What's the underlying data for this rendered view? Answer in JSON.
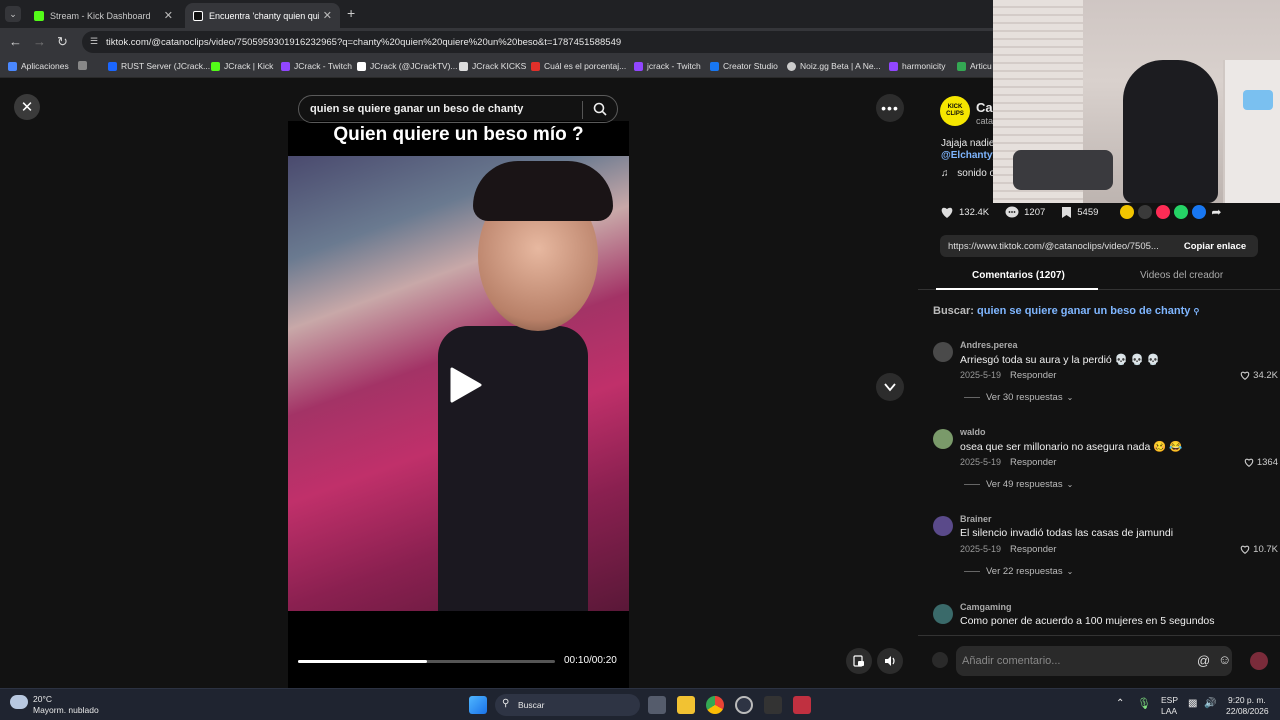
{
  "browser": {
    "tabs": [
      {
        "label": "Stream - Kick Dashboard",
        "favicon_color": "#53fc18"
      },
      {
        "label": "Encuentra 'chanty quien quiere",
        "favicon_color": "#ffffff"
      }
    ],
    "new_tab": "+",
    "url": "tiktok.com/@catanoclips/video/7505959301916232965?q=chanty%20quien%20quiere%20un%20beso&t=1787451588549",
    "bookmarks": [
      {
        "label": "Aplicaciones",
        "color": "#4a88ff"
      },
      {
        "label": "RUST Server (JCrack...",
        "color": "#1a66ff"
      },
      {
        "label": "JCrack | Kick",
        "color": "#53fc18"
      },
      {
        "label": "JCrack - Twitch",
        "color": "#9146ff"
      },
      {
        "label": "JCrack (@JCrackTV)...",
        "color": "#ffffff"
      },
      {
        "label": "JCrack KICKS",
        "color": "#ffffff"
      },
      {
        "label": "Cuál es el porcentaj...",
        "color": "#e0302a"
      },
      {
        "label": "jcrack - Twitch",
        "color": "#9146ff"
      },
      {
        "label": "Creator Studio",
        "color": "#1877f2"
      },
      {
        "label": "Noiz.gg Beta | A Ne...",
        "color": "#dddddd"
      },
      {
        "label": "harmonicity",
        "color": "#9146ff"
      },
      {
        "label": "Articu",
        "color": "#34a853"
      }
    ]
  },
  "player": {
    "search_query": "quien se quiere ganar un beso de chanty",
    "video_title": "Quien quiere un beso mío ?",
    "progress": 0.5,
    "time": "00:10/00:20"
  },
  "panel": {
    "channel_badge": "KICK CLIPS",
    "author_name": "Ca",
    "author_handle": "cata",
    "description": "Jajaja nadie",
    "mention": "@Elchantyy",
    "sound": "sonido o",
    "likes": "132.4K",
    "comments": "1207",
    "saves": "5459",
    "link": "https://www.tiktok.com/@catanoclips/video/7505...",
    "copy_link": "Copiar enlace",
    "tab_comments": "Comentarios (1207)",
    "tab_videos": "Videos del creador",
    "search_prefix": "Buscar:",
    "search_term": "quien se quiere ganar un beso de chanty",
    "comment_placeholder": "Añadir comentario...",
    "reply_label": "Responder",
    "comments_list": [
      {
        "user": "Andres.perea",
        "text": "Arriesgó toda su aura y la perdió 💀 💀 💀",
        "date": "2025-5-19",
        "likes": "34.2K",
        "more": "Ver 30 respuestas",
        "avatar_color": "#4a4a4a"
      },
      {
        "user": "waldo",
        "text": "osea que ser millonario no asegura nada 🥴 😂",
        "date": "2025-5-19",
        "likes": "1364",
        "more": "Ver 49 respuestas",
        "avatar_color": "#7a9a6a"
      },
      {
        "user": "Brainer",
        "text": "El silencio invadió todas las casas de jamundi",
        "date": "2025-5-19",
        "likes": "10.7K",
        "more": "Ver 22 respuestas",
        "avatar_color": "#5a4a8a"
      },
      {
        "user": "Camgaming",
        "text": "Como poner de acuerdo a 100 mujeres en 5 segundos",
        "date": "",
        "likes": "",
        "more": "",
        "avatar_color": "#3a6a6a"
      }
    ]
  },
  "taskbar": {
    "weather_temp": "20°C",
    "weather_desc": "Mayorm. nublado",
    "search": "Buscar",
    "lang": "ESP",
    "lang2": "LAA",
    "time": "9:20 p. m.",
    "date": "22/08/2026"
  }
}
